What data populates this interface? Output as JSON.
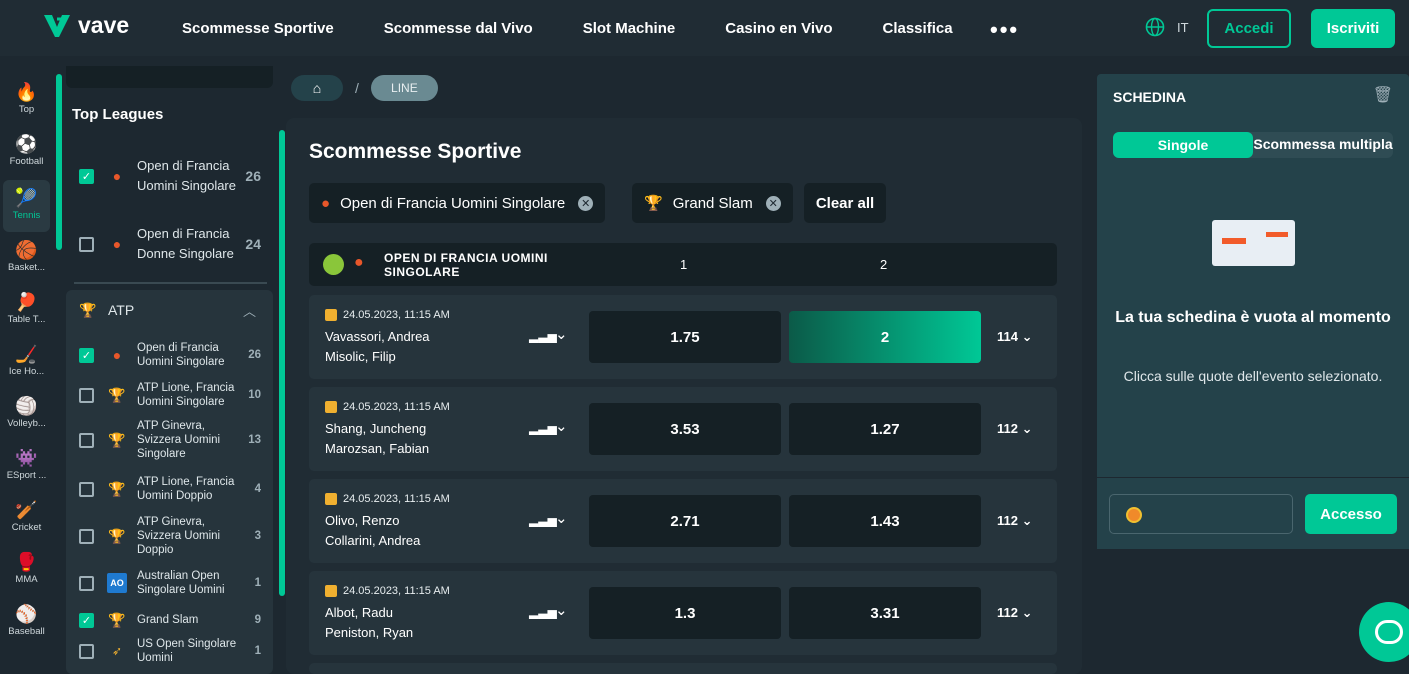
{
  "brand": {
    "name": "vave",
    "accent": "#00c896"
  },
  "nav": {
    "items": [
      "Scommesse Sportive",
      "Scommesse dal Vivo",
      "Slot Machine",
      "Casino en Vivo",
      "Classifica"
    ],
    "more": "•••",
    "lang": "IT",
    "login": "Accedi",
    "register": "Iscriviti"
  },
  "sports": [
    {
      "label": "Top",
      "icon": "fire-icon"
    },
    {
      "label": "Football",
      "icon": "football-icon"
    },
    {
      "label": "Tennis",
      "icon": "tennis-icon"
    },
    {
      "label": "Basket...",
      "icon": "basketball-icon"
    },
    {
      "label": "Table T...",
      "icon": "table-tennis-icon"
    },
    {
      "label": "Ice Ho...",
      "icon": "ice-hockey-icon"
    },
    {
      "label": "Volleyb...",
      "icon": "volleyball-icon"
    },
    {
      "label": "ESport ...",
      "icon": "esport-icon"
    },
    {
      "label": "Cricket",
      "icon": "cricket-icon"
    },
    {
      "label": "MMA",
      "icon": "mma-icon"
    },
    {
      "label": "Baseball",
      "icon": "baseball-icon"
    }
  ],
  "leagues": {
    "top_title": "Top Leagues",
    "top": [
      {
        "name": "Open di Francia Uomini Singolare",
        "count": "26",
        "checked": true
      },
      {
        "name": "Open di Francia Donne Singolare",
        "count": "24",
        "checked": false
      }
    ],
    "group_title": "ATP",
    "group": [
      {
        "name": "Open di Francia Uomini Singolare",
        "count": "26",
        "checked": true
      },
      {
        "name": "ATP Lione, Francia Uomini Singolare",
        "count": "10",
        "checked": false
      },
      {
        "name": "ATP Ginevra, Svizzera Uomini Singolare",
        "count": "13",
        "checked": false
      },
      {
        "name": "ATP Lione, Francia Uomini Doppio",
        "count": "4",
        "checked": false
      },
      {
        "name": "ATP Ginevra, Svizzera Uomini Doppio",
        "count": "3",
        "checked": false
      },
      {
        "name": "Australian Open Singolare Uomini",
        "count": "1",
        "checked": false
      },
      {
        "name": "Grand Slam",
        "count": "9",
        "checked": true
      },
      {
        "name": "US Open Singolare Uomini",
        "count": "1",
        "checked": false
      }
    ]
  },
  "breadcrumb": {
    "current": "LINE"
  },
  "main": {
    "title": "Scommesse Sportive",
    "filters": [
      "Open di Francia Uomini Singolare",
      "Grand Slam"
    ],
    "clear_all": "Clear all",
    "table_title": "OPEN DI FRANCIA UOMINI SINGOLARE",
    "col1": "1",
    "col2": "2",
    "matches": [
      {
        "date": "24.05.2023, 11:15 AM",
        "team1": "Vavassori, Andrea",
        "team2": "Misolic, Filip",
        "odd1": "1.75",
        "odd2": "2",
        "more": "114",
        "selected": "2"
      },
      {
        "date": "24.05.2023, 11:15 AM",
        "team1": "Shang, Juncheng",
        "team2": "Marozsan, Fabian",
        "odd1": "3.53",
        "odd2": "1.27",
        "more": "112"
      },
      {
        "date": "24.05.2023, 11:15 AM",
        "team1": "Olivo, Renzo",
        "team2": "Collarini, Andrea",
        "odd1": "2.71",
        "odd2": "1.43",
        "more": "112"
      },
      {
        "date": "24.05.2023, 11:15 AM",
        "team1": "Albot, Radu",
        "team2": "Peniston, Ryan",
        "odd1": "1.3",
        "odd2": "3.31",
        "more": "112"
      }
    ]
  },
  "slip": {
    "title": "SCHEDINA",
    "tab_single": "Singole",
    "tab_multi": "Scommessa multipla",
    "empty_title": "La tua schedina è vuota al momento",
    "empty_sub": "Clicca sulle quote dell'evento selezionato.",
    "access": "Accesso"
  }
}
